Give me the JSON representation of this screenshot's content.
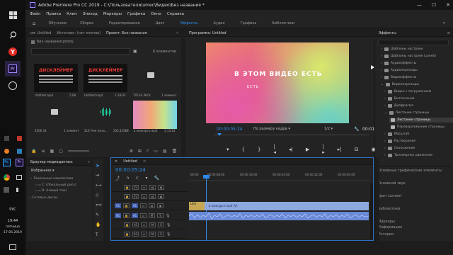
{
  "taskbar": {
    "language": "РУС",
    "time": "19:44",
    "weekday": "пятница",
    "date": "17.05.2019"
  },
  "window": {
    "title": "Adobe Premiere Pro CC 2019 - C:\\Пользователи\\umeс\\Видео\\Без названия *"
  },
  "menu": [
    "Файл",
    "Правка",
    "Клип",
    "Эпизод",
    "Маркеры",
    "Графика",
    "Окно",
    "Справка"
  ],
  "workspaces": {
    "items": [
      "Обучение",
      "Сборка",
      "Редактирование",
      "Цвет",
      "Эффекты",
      "Аудио",
      "Графика",
      "Библиотеки"
    ],
    "active": "Эффекты"
  },
  "project_panel": {
    "tabs": [
      "ия: Untitled",
      "Источник: (нет клипов)",
      "Проект: Без названия"
    ],
    "active_tab": "Проект: Без названия",
    "project_file": "Без названия.prproj",
    "item_count": "6 элементов",
    "items": [
      {
        "name": "Untitled.mp4",
        "duration": "5:08",
        "overlay_title": "ДИСКЛЕЙМЕР",
        "kind": "video"
      },
      {
        "name": "Untitled.mp4",
        "duration": "1:18:03",
        "overlay_title": "ДИСКЛЕЙМЕР",
        "kind": "video"
      },
      {
        "name": "TITLES PACK",
        "duration": "1 элемент",
        "kind": "folder"
      },
      {
        "name": "4506.33",
        "duration": "1 элемент",
        "kind": "folder"
      },
      {
        "name": "214 Free Icons...",
        "duration": "235.42588",
        "kind": "audio"
      },
      {
        "name": "в конкурсе.mp4",
        "duration": "1:13:14",
        "kind": "gradient"
      }
    ]
  },
  "program_monitor": {
    "tab": "Программа: Untitled",
    "overlay_line1": "В ЭТОМ ВИДЕО ЕСТЬ",
    "overlay_line2": "ЕСТЬ",
    "timecode": "00:00:05:24",
    "fit": "По размеру кадра",
    "resolution": "1/2",
    "duration": "00:01:18:03"
  },
  "effects_panel": {
    "title": "Эффекты",
    "tree": [
      {
        "label": "Шаблоны настроек",
        "indent": 1,
        "type": "folder"
      },
      {
        "label": "Шаблоны настроек Lumetri",
        "indent": 1,
        "type": "folder"
      },
      {
        "label": "Аудиоэффекты",
        "indent": 1,
        "type": "folder"
      },
      {
        "label": "Аудиопереходы",
        "indent": 1,
        "type": "folder"
      },
      {
        "label": "Видеоэффекты",
        "indent": 1,
        "type": "folder"
      },
      {
        "label": "Видеопереходы",
        "indent": 1,
        "type": "folder-open"
      },
      {
        "label": "Видео с погружением",
        "indent": 2,
        "type": "folder"
      },
      {
        "label": "Вытеснение",
        "indent": 2,
        "type": "folder"
      },
      {
        "label": "Диафрагма",
        "indent": 2,
        "type": "folder"
      },
      {
        "label": "Листание страницы",
        "indent": 2,
        "type": "folder-open"
      },
      {
        "label": "Листание страницы",
        "indent": 3,
        "type": "item",
        "selected": true
      },
      {
        "label": "Переворачивание страницы",
        "indent": 3,
        "type": "item"
      },
      {
        "label": "Масштаб",
        "indent": 2,
        "type": "folder"
      },
      {
        "label": "Растворение",
        "indent": 2,
        "type": "folder"
      },
      {
        "label": "Скольжение",
        "indent": 2,
        "type": "folder"
      },
      {
        "label": "Трехмерное движение",
        "indent": 2,
        "type": "folder"
      }
    ],
    "sections": [
      "Основные графические элементы",
      "Основной звук",
      "Цвет Lumetri",
      "Библиотеки",
      "Маркеры",
      "История",
      "Информация"
    ]
  },
  "media_browser": {
    "title": "Браузер медиаданных",
    "favorites": "Избранное",
    "local": "Локальные накопители",
    "drives": [
      "C: (Локальный диск)",
      "D: (Новый том)"
    ],
    "network": "Сетевые диски"
  },
  "timeline": {
    "tab": "Untitled",
    "timecode": "00:00:05:24",
    "ruler": [
      "00:00",
      "00:00:08:00",
      "00:00:16:00",
      "00:00:24:00",
      "00:00:32:00",
      "00:00:40:00"
    ],
    "video_tracks": [
      "V3",
      "V2",
      "V1"
    ],
    "audio_tracks": [
      "A1",
      "A2",
      "A3"
    ],
    "source_v": "V1",
    "source_a": "A1",
    "clip_v1_a": "Unti",
    "clip_v1_b": "в конкурсе.mp4 [V]"
  },
  "colors": {
    "accent": "#2d8ceb",
    "video_clip": "#8ea8e0",
    "audio_clip": "#6a8ad8",
    "playhead": "#2d8ceb"
  }
}
